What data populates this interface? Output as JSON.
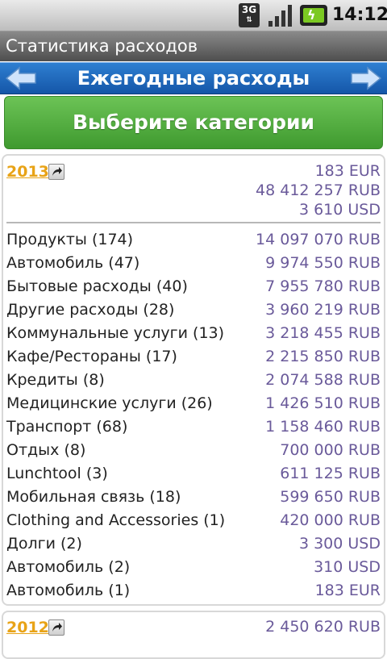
{
  "status": {
    "network": "3G",
    "time": "14:12"
  },
  "app": {
    "title": "Статистика расходов"
  },
  "nav": {
    "title": "Ежегодные расходы"
  },
  "category_button": {
    "label": "Выберите категории"
  },
  "years": [
    {
      "year": "2013",
      "totals": [
        "183 EUR",
        "48 412 257 RUB",
        "3 610 USD"
      ],
      "rows": [
        {
          "name": "Продукты (174)",
          "amount": "14 097 070 RUB"
        },
        {
          "name": "Автомобиль (47)",
          "amount": "9 974 550 RUB"
        },
        {
          "name": "Бытовые расходы (40)",
          "amount": "7 955 780 RUB"
        },
        {
          "name": "Другие расходы (28)",
          "amount": "3 960 219 RUB"
        },
        {
          "name": "Коммунальные услуги (13)",
          "amount": "3 218 455 RUB"
        },
        {
          "name": "Кафе/Рестораны (17)",
          "amount": "2 215 850 RUB"
        },
        {
          "name": "Кредиты (8)",
          "amount": "2 074 588 RUB"
        },
        {
          "name": "Медицинские услуги (26)",
          "amount": "1 426 510 RUB"
        },
        {
          "name": "Транспорт (68)",
          "amount": "1 158 460 RUB"
        },
        {
          "name": "Отдых (8)",
          "amount": "700 000 RUB"
        },
        {
          "name": "Lunchtool (3)",
          "amount": "611 125 RUB"
        },
        {
          "name": "Мобильная связь (18)",
          "amount": "599 650 RUB"
        },
        {
          "name": "Clothing and Accessories (1)",
          "amount": "420 000 RUB"
        },
        {
          "name": "Долги (2)",
          "amount": "3 300 USD"
        },
        {
          "name": "Автомобиль (2)",
          "amount": "310 USD"
        },
        {
          "name": "Автомобиль (1)",
          "amount": "183 EUR"
        }
      ]
    },
    {
      "year": "2012",
      "totals": [
        "2 450 620 RUB"
      ]
    }
  ]
}
